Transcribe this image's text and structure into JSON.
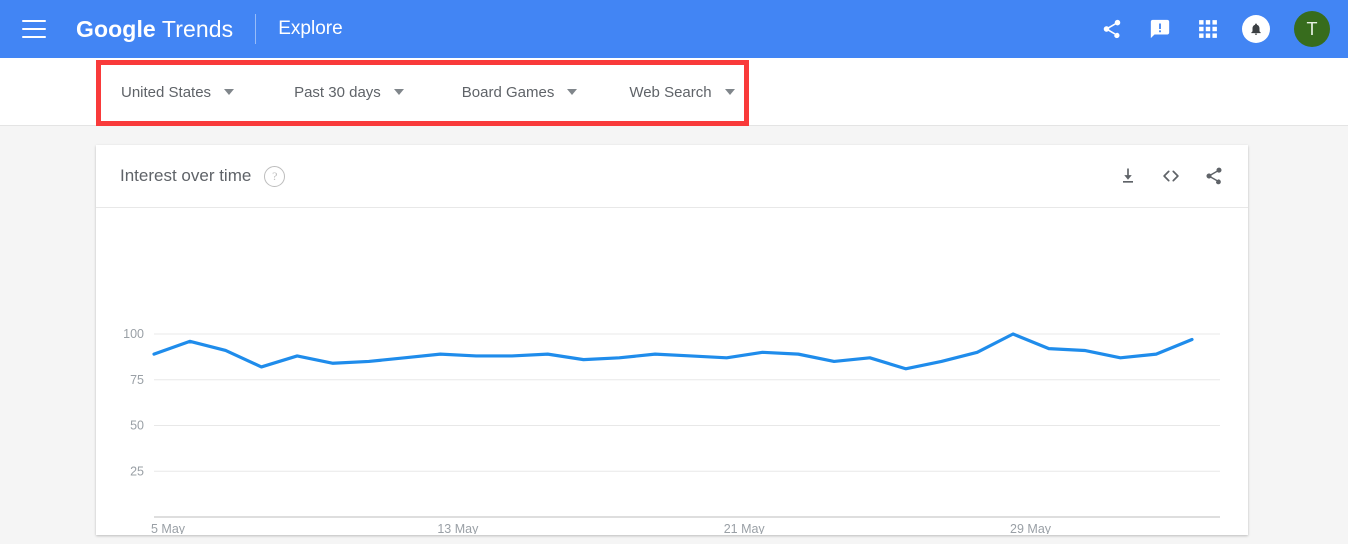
{
  "header": {
    "menu_icon": "hamburger-menu-icon",
    "brand_bold": "Google",
    "brand_light": " Trends",
    "explore_label": "Explore",
    "icons": [
      {
        "name": "share-icon",
        "label": "Share"
      },
      {
        "name": "feedback-icon",
        "label": "Send feedback"
      },
      {
        "name": "apps-grid-icon",
        "label": "Google apps"
      },
      {
        "name": "notifications-bell-icon",
        "label": "Notifications"
      }
    ],
    "avatar_initial": "T",
    "background_color": "#4285f4",
    "avatar_color": "#376c1d"
  },
  "filters": {
    "highlight_color": "#f93a3a",
    "items": [
      {
        "name": "filter-location",
        "label": "United States"
      },
      {
        "name": "filter-time-range",
        "label": "Past 30 days"
      },
      {
        "name": "filter-category",
        "label": "Board Games"
      },
      {
        "name": "filter-search-type",
        "label": "Web Search"
      }
    ]
  },
  "card": {
    "title": "Interest over time",
    "help_glyph": "?",
    "tools": [
      {
        "name": "download-csv-icon",
        "label": "Download"
      },
      {
        "name": "embed-code-icon",
        "label": "Embed"
      },
      {
        "name": "share-chart-icon",
        "label": "Share"
      }
    ]
  },
  "chart_data": {
    "type": "line",
    "title": "Interest over time",
    "xlabel": "",
    "ylabel": "",
    "ylim": [
      0,
      100
    ],
    "yticks": [
      25,
      50,
      75,
      100
    ],
    "ytick_labels": [
      "25",
      "50",
      "75",
      "100"
    ],
    "grid": true,
    "legend": false,
    "line_color": "#1f8ceb",
    "xtick_labels": [
      "5 May",
      "13 May",
      "21 May",
      "29 May"
    ],
    "xtick_indices": [
      0,
      8,
      16,
      24
    ],
    "x": [
      "5 May",
      "6 May",
      "7 May",
      "8 May",
      "9 May",
      "10 May",
      "11 May",
      "12 May",
      "13 May",
      "14 May",
      "15 May",
      "16 May",
      "17 May",
      "18 May",
      "19 May",
      "20 May",
      "21 May",
      "22 May",
      "23 May",
      "24 May",
      "25 May",
      "26 May",
      "27 May",
      "28 May",
      "29 May",
      "30 May",
      "31 May",
      "1 Jun",
      "2 Jun",
      "3 Jun"
    ],
    "values": [
      89,
      96,
      91,
      82,
      88,
      84,
      85,
      87,
      89,
      88,
      88,
      89,
      86,
      87,
      89,
      88,
      87,
      90,
      89,
      85,
      87,
      81,
      85,
      90,
      100,
      92,
      91,
      87,
      89,
      97
    ],
    "series": [
      {
        "name": "Board Games",
        "values": [
          89,
          96,
          91,
          82,
          88,
          84,
          85,
          87,
          89,
          88,
          88,
          89,
          86,
          87,
          89,
          88,
          87,
          90,
          89,
          85,
          87,
          81,
          85,
          90,
          100,
          92,
          91,
          87,
          89,
          97
        ]
      }
    ]
  }
}
